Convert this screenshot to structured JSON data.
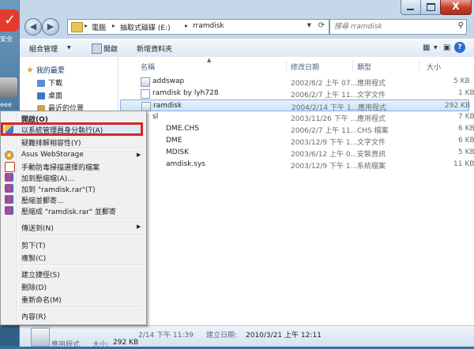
{
  "desktop": {
    "labels": [
      "安全",
      "eee"
    ]
  },
  "window_controls": {
    "minimize": "–",
    "maximize": "□",
    "close": "X"
  },
  "address_bar": {
    "crumbs": [
      "電腦",
      "抽取式磁碟 (E:)",
      "rramdisk"
    ]
  },
  "search": {
    "placeholder": "搜尋 rramdisk"
  },
  "toolbar": {
    "organize": "組合管理",
    "open": "開啟",
    "new_folder": "新增資料夾",
    "help": "?"
  },
  "left_pane": {
    "favorites": "我的最愛",
    "items": [
      "下載",
      "桌面",
      "最近的位置"
    ]
  },
  "columns": {
    "name": "名稱",
    "date": "修改日期",
    "type": "類型",
    "size": "大小"
  },
  "files": [
    {
      "name": "addswap",
      "date": "2002/8/2 上午 07...",
      "type": "應用程式",
      "size": "5 KB",
      "kind": "exe"
    },
    {
      "name": "ramdisk by lyh728",
      "date": "2006/2/7 上午 11...",
      "type": "文字文件",
      "size": "1 KB",
      "kind": "txt"
    },
    {
      "name": "ramdisk",
      "date": "2004/2/14 下午 1...",
      "type": "應用程式",
      "size": "292 KB",
      "kind": "exe"
    },
    {
      "name": "sl",
      "date": "2003/11/26 下午 ...",
      "type": "應用程式",
      "size": "7 KB",
      "kind": "exe"
    },
    {
      "name": "DME.CHS",
      "date": "2006/2/7 上午 11...",
      "type": "CHS 檔案",
      "size": "6 KB",
      "kind": "txt"
    },
    {
      "name": "DME",
      "date": "2003/12/9 下午 1...",
      "type": "文字文件",
      "size": "6 KB",
      "kind": "txt"
    },
    {
      "name": "MDISK",
      "date": "2003/6/12 上午 0...",
      "type": "安裝資訊",
      "size": "5 KB",
      "kind": "sys"
    },
    {
      "name": "amdisk.sys",
      "date": "2003/12/9 下午 1...",
      "type": "系統檔案",
      "size": "11 KB",
      "kind": "sys"
    }
  ],
  "status_bar": {
    "line1": "2/14 下午 11:39",
    "created_label": "建立日期:",
    "created_value": "2010/3/21 上午 12:11",
    "type": "應用程式",
    "size_label": "大小:",
    "size_value": "292 KB"
  },
  "context_menu": {
    "open": "開啟(O)",
    "run_as_admin": "以系統管理員身分執行(A)",
    "troubleshoot": "疑難排解相容性(Y)",
    "asus": "Asus WebStorage",
    "scan": "手動防毒掃描選擇的檔案",
    "add_archive": "加到壓縮檔(A)...",
    "add_rar": "加到 \"ramdisk.rar\"(T)",
    "compress_email": "壓縮並郵寄...",
    "compress_rar_email": "壓縮成 \"ramdisk.rar\" 並郵寄",
    "send_to": "傳送到(N)",
    "cut": "剪下(T)",
    "copy": "複製(C)",
    "create_shortcut": "建立捷徑(S)",
    "delete": "刪除(D)",
    "rename": "重新命名(M)",
    "properties": "內容(R)"
  },
  "colors": {
    "highlight_border": "#d4262a",
    "selection": "#cde3f8"
  }
}
